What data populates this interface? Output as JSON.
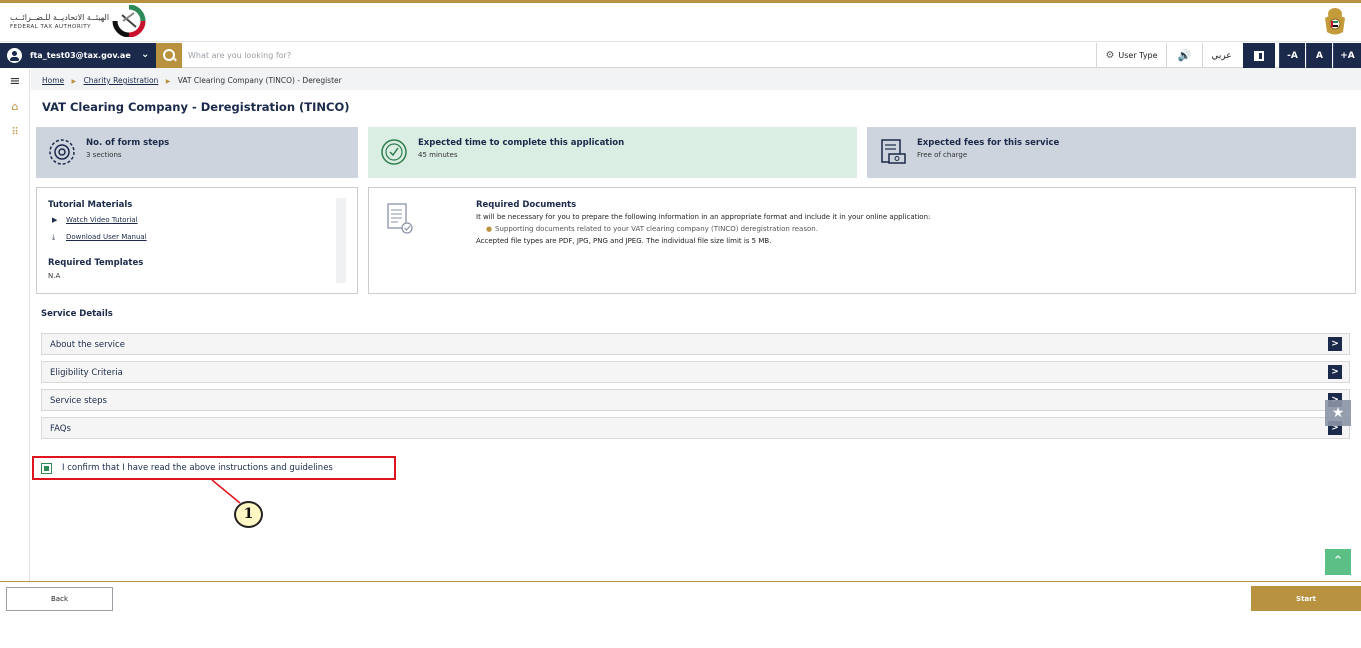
{
  "header": {
    "logo_ar": "الهيئــة الاتحاديــة للـضــرائــب",
    "logo_en": "FEDERAL TAX AUTHORITY",
    "emblem_icon": "uae-emblem-icon"
  },
  "navbar": {
    "user_email": "fta_test03@tax.gov.ae",
    "search_placeholder": "What are you looking for?",
    "user_type_label": "User Type",
    "sound_icon": "🔊",
    "language_label": "عربي",
    "font_decrease": "-A",
    "font_normal": "A",
    "font_increase": "+A"
  },
  "breadcrumb": {
    "home": "Home",
    "charity": "Charity Registration",
    "current": "VAT Clearing Company (TINCO) - Deregister"
  },
  "page_title": "VAT Clearing Company - Deregistration (TINCO)",
  "cards": {
    "steps_title": "No. of form steps",
    "steps_value": "3 sections",
    "time_title": "Expected time to complete this application",
    "time_value": "45 minutes",
    "fees_title": "Expected fees for this service",
    "fees_value": "Free of charge"
  },
  "tutorial": {
    "title": "Tutorial Materials",
    "video_link": "Watch Video Tutorial",
    "manual_link": "Download User Manual",
    "templates_title": "Required Templates",
    "templates_value": "N.A"
  },
  "required_docs": {
    "title": "Required Documents",
    "intro": "It will be necessary for you to prepare the following information in an appropriate format and include it in your online application:",
    "item1": "Supporting documents related to your VAT clearing company (TINCO) deregistration reason.",
    "file_types": "Accepted file types are PDF, JPG, PNG and JPEG. The individual file size limit is 5 MB."
  },
  "service_details": {
    "title": "Service Details",
    "items": [
      {
        "label": "About the service"
      },
      {
        "label": "Eligibility Criteria"
      },
      {
        "label": "Service steps"
      },
      {
        "label": "FAQs"
      }
    ]
  },
  "confirm": {
    "checked": true,
    "label": "I confirm that I have read the above instructions and guidelines"
  },
  "callout": {
    "number": "1"
  },
  "footer": {
    "back_label": "Back",
    "start_label": "Start"
  },
  "colors": {
    "brand_navy": "#1b2a4a",
    "brand_gold": "#b8923e",
    "highlight_red": "#e0141e",
    "success_green": "#5cbf86"
  }
}
